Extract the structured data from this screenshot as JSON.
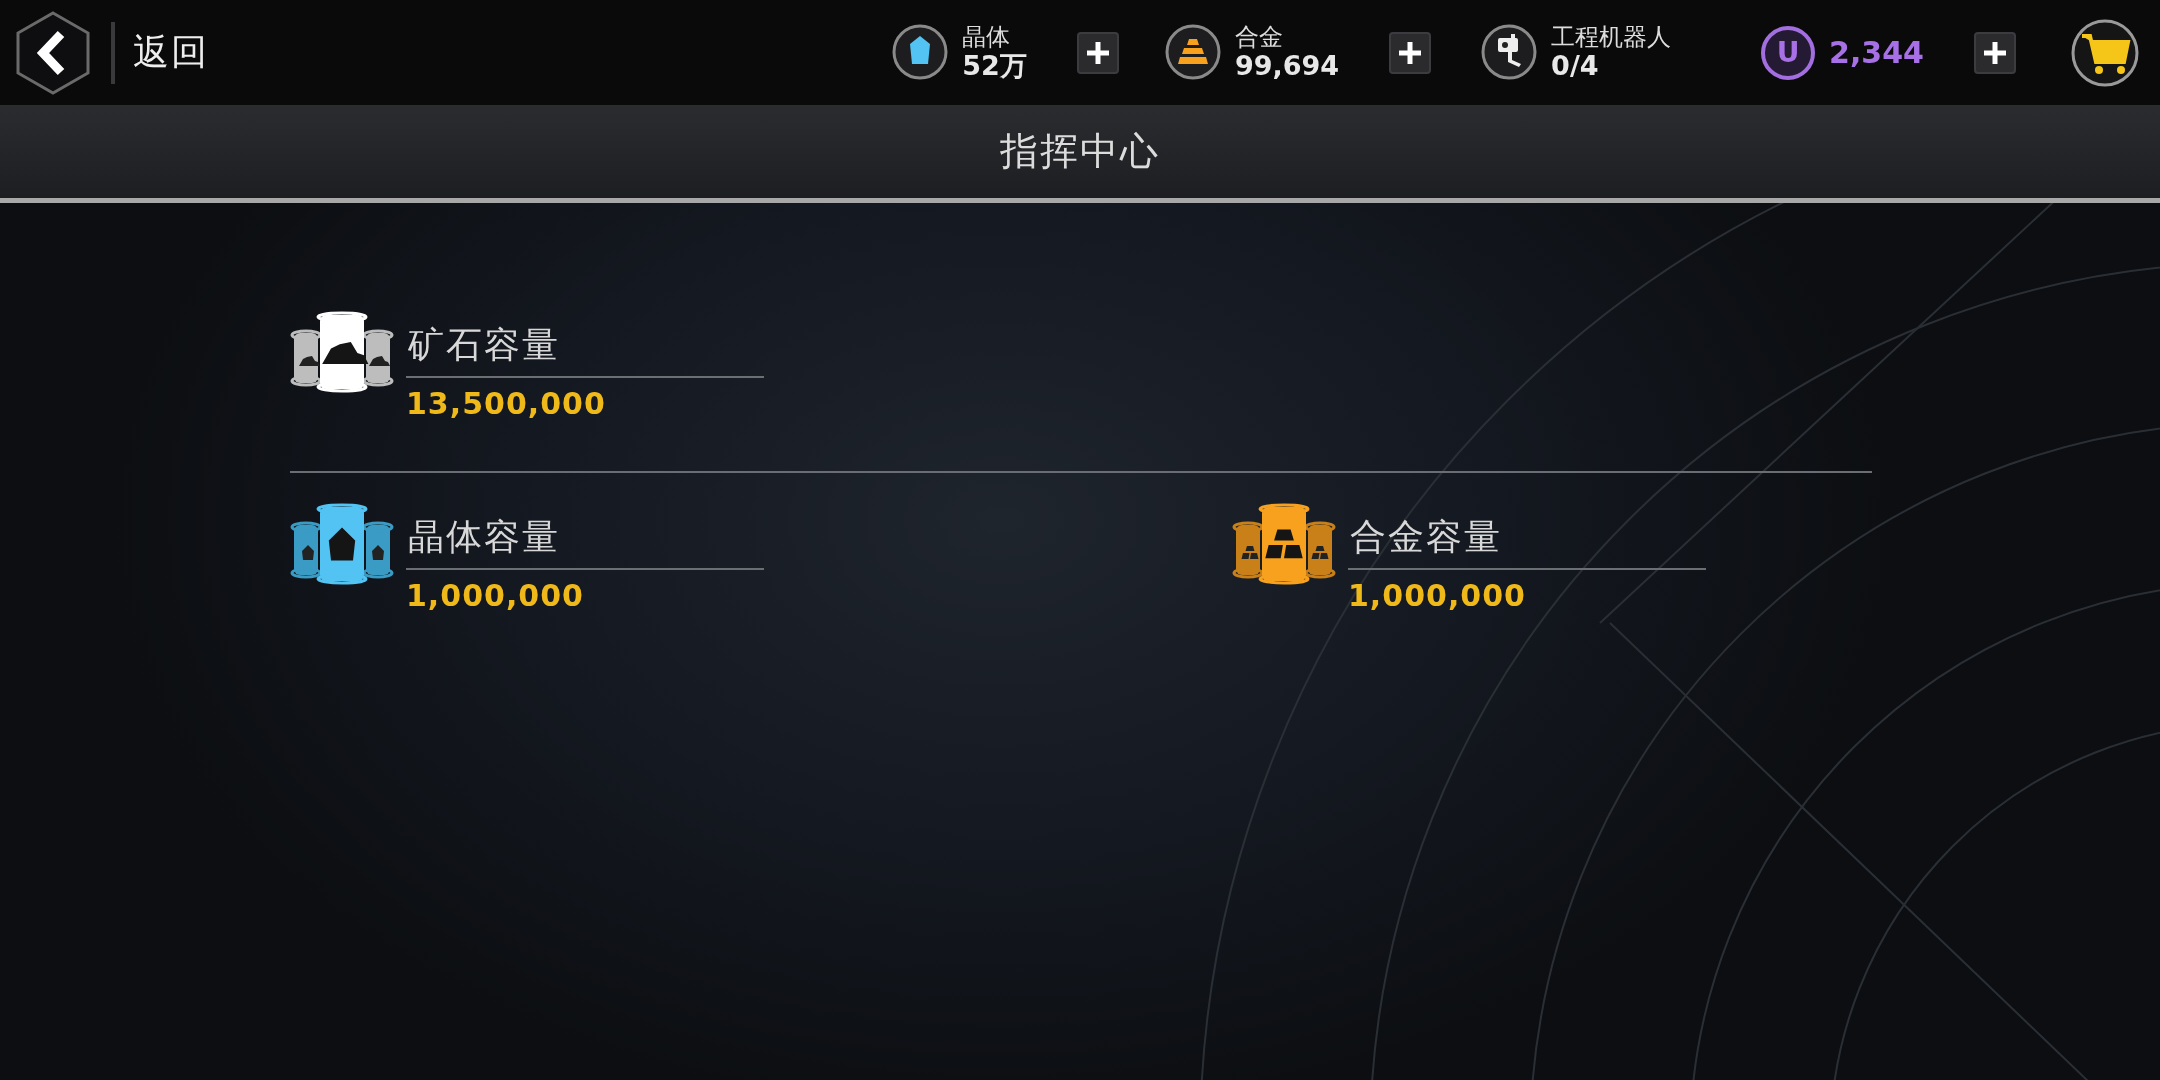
{
  "back": {
    "label": "返回"
  },
  "resources": [
    {
      "kind": "crystal",
      "name": "晶体",
      "amount": "52万",
      "add_button": true
    },
    {
      "kind": "alloy",
      "name": "合金",
      "amount": "99,694",
      "add_button": true
    },
    {
      "kind": "robot",
      "name": "工程机器人",
      "amount": "0/4",
      "add_button": false
    },
    {
      "kind": "coin",
      "symbol": "U",
      "amount": "2,344",
      "add_button": true
    }
  ],
  "title": "指挥中心",
  "storage_rows": [
    [
      {
        "kind": "ore",
        "label": "矿石容量",
        "value": "13,500,000"
      }
    ],
    [
      {
        "kind": "crystal",
        "label": "晶体容量",
        "value": "1,000,000"
      },
      {
        "kind": "alloy",
        "label": "合金容量",
        "value": "1,000,000"
      }
    ]
  ]
}
